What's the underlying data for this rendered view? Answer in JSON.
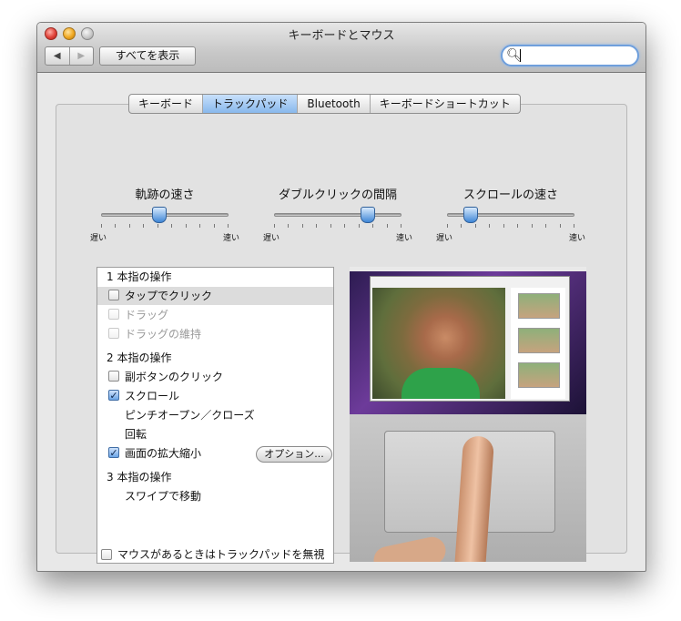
{
  "window": {
    "title": "キーボードとマウス",
    "back_label": "◀",
    "forward_label": "▶",
    "show_all_label": "すべてを表示",
    "search": {
      "value": "",
      "placeholder": ""
    }
  },
  "tabs": [
    {
      "label": "キーボード",
      "active": false
    },
    {
      "label": "トラックパッド",
      "active": true
    },
    {
      "label": "Bluetooth",
      "active": false
    },
    {
      "label": "キーボードショートカット",
      "active": false
    }
  ],
  "sliders": [
    {
      "label": "軌跡の速さ",
      "min_label": "遅い",
      "max_label": "速い",
      "value_fraction": 0.45
    },
    {
      "label": "ダブルクリックの間隔",
      "min_label": "遅い",
      "max_label": "速い",
      "value_fraction": 0.8
    },
    {
      "label": "スクロールの速さ",
      "min_label": "遅い",
      "max_label": "速い",
      "value_fraction": 0.25
    }
  ],
  "gestures": {
    "one_finger": {
      "header": "1 本指の操作",
      "tap_to_click": {
        "label": "タップでクリック",
        "checked": false
      },
      "drag": {
        "label": "ドラッグ",
        "checked": false,
        "enabled": false
      },
      "drag_lock": {
        "label": "ドラッグの維持",
        "checked": false,
        "enabled": false
      }
    },
    "two_finger": {
      "header": "2 本指の操作",
      "secondary_click": {
        "label": "副ボタンのクリック",
        "checked": false
      },
      "scroll": {
        "label": "スクロール",
        "checked": true
      },
      "pinch": {
        "label": "ピンチオープン／クローズ"
      },
      "rotate": {
        "label": "回転"
      },
      "zoom": {
        "label": "画面の拡大縮小",
        "checked": true,
        "options_label": "オプション..."
      }
    },
    "three_finger": {
      "header": "3 本指の操作",
      "swipe": {
        "label": "スワイプで移動"
      }
    }
  },
  "ignore_trackpad": {
    "label": "マウスがあるときはトラックパッドを無視",
    "checked": false
  },
  "icons": [
    "search-icon",
    "back-arrow-icon",
    "forward-arrow-icon",
    "checkmark-icon"
  ]
}
